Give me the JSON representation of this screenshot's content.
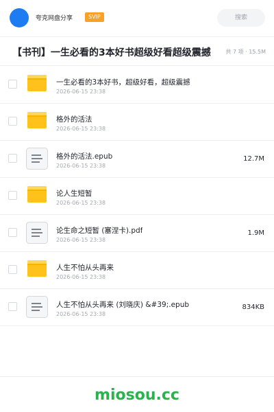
{
  "header": {
    "app_name": "夸克网盘分享",
    "badge": "SVIP",
    "search_label": "搜索",
    "accent_color": "#1e7cf2",
    "badge_color": "#f7a12a"
  },
  "folder": {
    "title": "【书刊】一生必看的3本好书超级好看超级震撼",
    "meta": "共 7 项 · 15.5M"
  },
  "files": [
    {
      "name": "一生必看的3本好书，超级好看，超级震撼",
      "date": "2026-06-15 23:38",
      "size": "",
      "type": "folder-icon"
    },
    {
      "name": "格外的活法",
      "date": "2026-06-15 23:38",
      "size": "",
      "type": "folder-icon"
    },
    {
      "name": "格外的活法.epub",
      "date": "2026-06-15 23:38",
      "size": "12.7M",
      "type": "document-icon"
    },
    {
      "name": "论人生短暂",
      "date": "2026-06-15 23:38",
      "size": "",
      "type": "folder-icon"
    },
    {
      "name": "论生命之短暂 (塞涅卡).pdf",
      "date": "2026-06-15 23:38",
      "size": "1.9M",
      "type": "document-icon"
    },
    {
      "name": "人生不怕从头再来",
      "date": "2026-06-15 23:38",
      "size": "",
      "type": "folder-icon"
    },
    {
      "name": "人生不怕从头再来 (刘晓庆) &#39;.epub",
      "date": "2026-06-15 23:38",
      "size": "834KB",
      "type": "document-icon"
    }
  ],
  "footer": {
    "brand": "miosou.cc",
    "brand_color": "#2bb24c"
  }
}
